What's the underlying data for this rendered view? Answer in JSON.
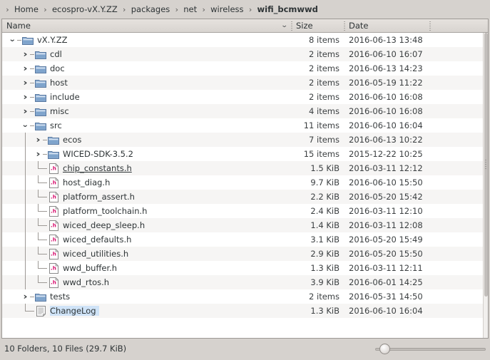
{
  "window": {
    "title": "wifi_bcmwwd",
    "background_color": "#d6d2ce"
  },
  "breadcrumb": {
    "separator": "›",
    "items": [
      {
        "label": "Home",
        "current": false
      },
      {
        "label": "ecospro-vX.Y.ZZ",
        "current": false
      },
      {
        "label": "packages",
        "current": false
      },
      {
        "label": "net",
        "current": false
      },
      {
        "label": "wireless",
        "current": false
      },
      {
        "label": "wifi_bcmwwd",
        "current": true
      }
    ]
  },
  "columns": {
    "name": "Name",
    "size": "Size",
    "date": "Date",
    "sort_indicator": "⌄"
  },
  "rows": [
    {
      "name": "vX.Y.ZZ",
      "size": "8 items",
      "date": "2016-06-13 13:48",
      "depth": 0,
      "kind": "folder",
      "expanded": true,
      "state": ""
    },
    {
      "name": "cdl",
      "size": "2 items",
      "date": "2016-06-10 16:07",
      "depth": 1,
      "kind": "folder",
      "expanded": false,
      "state": ""
    },
    {
      "name": "doc",
      "size": "2 items",
      "date": "2016-06-13 14:23",
      "depth": 1,
      "kind": "folder",
      "expanded": false,
      "state": ""
    },
    {
      "name": "host",
      "size": "2 items",
      "date": "2016-05-19 11:22",
      "depth": 1,
      "kind": "folder",
      "expanded": false,
      "state": ""
    },
    {
      "name": "include",
      "size": "2 items",
      "date": "2016-06-10 16:08",
      "depth": 1,
      "kind": "folder",
      "expanded": false,
      "state": ""
    },
    {
      "name": "misc",
      "size": "4 items",
      "date": "2016-06-10 16:08",
      "depth": 1,
      "kind": "folder",
      "expanded": false,
      "state": ""
    },
    {
      "name": "src",
      "size": "11 items",
      "date": "2016-06-10 16:04",
      "depth": 1,
      "kind": "folder",
      "expanded": true,
      "state": ""
    },
    {
      "name": "ecos",
      "size": "7 items",
      "date": "2016-06-13 10:22",
      "depth": 2,
      "kind": "folder",
      "expanded": false,
      "state": ""
    },
    {
      "name": "WICED-SDK-3.5.2",
      "size": "15 items",
      "date": "2015-12-22 10:25",
      "depth": 2,
      "kind": "folder",
      "expanded": false,
      "state": ""
    },
    {
      "name": "chip_constants.h",
      "size": "1.5 KiB",
      "date": "2016-03-11 12:12",
      "depth": 2,
      "kind": "header",
      "expanded": false,
      "state": "hover"
    },
    {
      "name": "host_diag.h",
      "size": "9.7 KiB",
      "date": "2016-06-10 15:50",
      "depth": 2,
      "kind": "header",
      "expanded": false,
      "state": ""
    },
    {
      "name": "platform_assert.h",
      "size": "2.2 KiB",
      "date": "2016-05-20 15:42",
      "depth": 2,
      "kind": "header",
      "expanded": false,
      "state": ""
    },
    {
      "name": "platform_toolchain.h",
      "size": "2.4 KiB",
      "date": "2016-03-11 12:10",
      "depth": 2,
      "kind": "header",
      "expanded": false,
      "state": ""
    },
    {
      "name": "wiced_deep_sleep.h",
      "size": "1.4 KiB",
      "date": "2016-03-11 12:08",
      "depth": 2,
      "kind": "header",
      "expanded": false,
      "state": ""
    },
    {
      "name": "wiced_defaults.h",
      "size": "3.1 KiB",
      "date": "2016-05-20 15:49",
      "depth": 2,
      "kind": "header",
      "expanded": false,
      "state": ""
    },
    {
      "name": "wiced_utilities.h",
      "size": "2.9 KiB",
      "date": "2016-05-20 15:50",
      "depth": 2,
      "kind": "header",
      "expanded": false,
      "state": ""
    },
    {
      "name": "wwd_buffer.h",
      "size": "1.3 KiB",
      "date": "2016-03-11 12:11",
      "depth": 2,
      "kind": "header",
      "expanded": false,
      "state": ""
    },
    {
      "name": "wwd_rtos.h",
      "size": "3.9 KiB",
      "date": "2016-06-01 14:25",
      "depth": 2,
      "kind": "header",
      "expanded": false,
      "state": ""
    },
    {
      "name": "tests",
      "size": "2 items",
      "date": "2016-05-31 14:50",
      "depth": 1,
      "kind": "folder",
      "expanded": false,
      "state": ""
    },
    {
      "name": "ChangeLog",
      "size": "1.3 KiB",
      "date": "2016-06-10 16:04",
      "depth": 1,
      "kind": "text",
      "expanded": false,
      "state": "picked"
    }
  ],
  "icons": {
    "folder": "folder-icon",
    "header": "header-file-icon",
    "text": "text-file-icon",
    "expander_open": "chevron-down-icon",
    "expander_closed": "chevron-right-icon",
    "sort": "chevron-down-icon"
  },
  "statusbar": {
    "summary": "10 Folders, 10 Files (29.7 KiB)"
  },
  "zoom_slider": {
    "value": 4,
    "min": 0,
    "max": 100
  },
  "colors": {
    "chrome": "#d6d2ce",
    "row_even": "#ffffff",
    "row_odd": "#f6f5f4",
    "folder_blue": "#7a9cc6",
    "header_pink": "#d70f6e",
    "selection": "#cfe3f7",
    "text": "#2e3436"
  }
}
